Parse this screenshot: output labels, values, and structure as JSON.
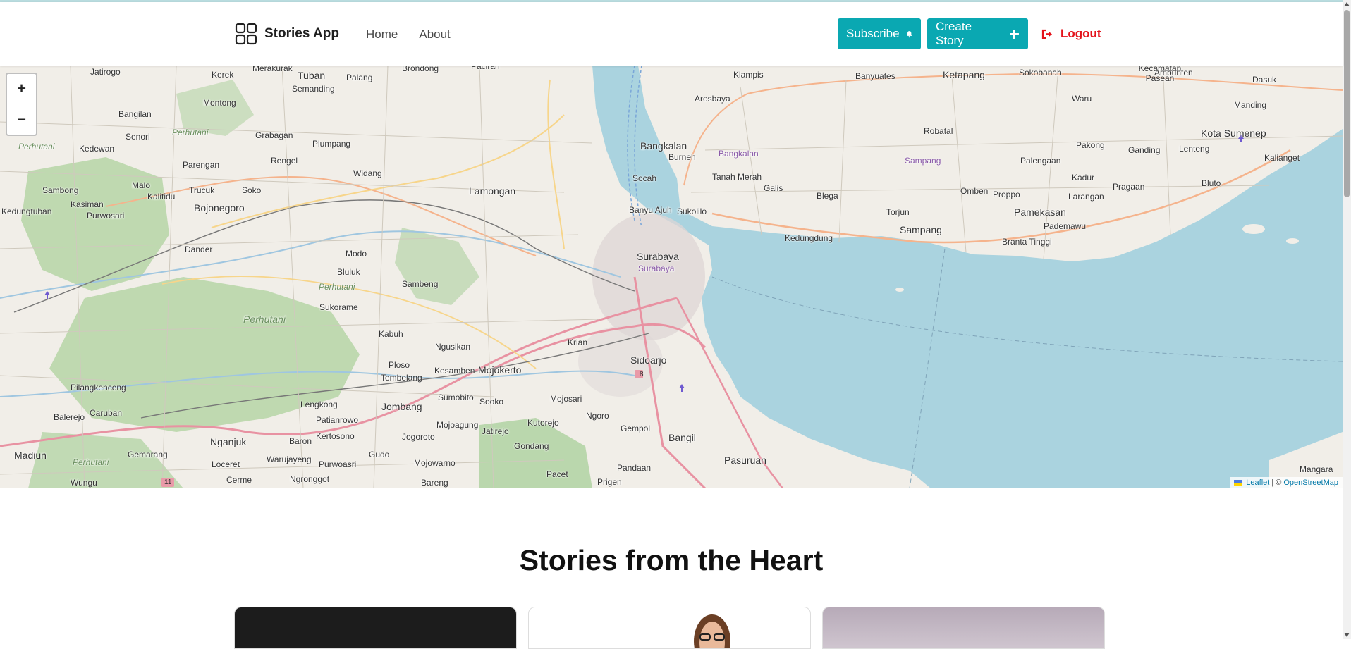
{
  "app": {
    "brand_name": "Stories App",
    "nav": {
      "home": "Home",
      "about": "About"
    },
    "buttons": {
      "subscribe": "Subscribe",
      "create_story": "Create Story",
      "logout": "Logout"
    },
    "accent_color": "#0aa8b2",
    "logout_color": "#e4131b"
  },
  "map": {
    "zoom_in": "+",
    "zoom_out": "−",
    "attribution": {
      "leaflet": "Leaflet",
      "separator": "| ©",
      "osm": "OpenStreetMap"
    },
    "labels": {
      "jatirogo": "Jatirogo",
      "merakurak": "Merakurak",
      "tuban": "Tuban",
      "palang": "Palang",
      "brondong": "Brondong",
      "paciran": "Paciran",
      "kerek": "Kerek",
      "semanding": "Semanding",
      "montong": "Montong",
      "bangilan": "Bangilan",
      "perhutani1": "Perhutani",
      "senori": "Senori",
      "grabagan": "Grabagan",
      "plumpang": "Plumpang",
      "perhutani2": "Perhutani",
      "kedewan": "Kedewan",
      "parengan": "Parengan",
      "rengel": "Rengel",
      "widang": "Widang",
      "lamongan": "Lamongan",
      "sambong": "Sambong",
      "malo": "Malo",
      "trucuk": "Trucuk",
      "soko": "Soko",
      "kasiman": "Kasiman",
      "kalitidu": "Kalitidu",
      "bojonegoro": "Bojonegoro",
      "kedungtuban": "Kedungtuban",
      "purwosari": "Purwosari",
      "dander": "Dander",
      "modo": "Modo",
      "bluluk": "Bluluk",
      "sambeng": "Sambeng",
      "perhutani3": "Perhutani",
      "sukorame": "Sukorame",
      "perhutani4": "Perhutani",
      "kabuh": "Kabuh",
      "ngusikan": "Ngusikan",
      "ploso": "Ploso",
      "kesamben": "Kesamben",
      "mojokerto": "Mojokerto",
      "tembelang": "Tembelang",
      "pilangkenceng": "Pilangkenceng",
      "lengkong": "Lengkong",
      "sumobito": "Sumobito",
      "sooko": "Sooko",
      "jombang": "Jombang",
      "balerejo": "Balerejo",
      "caruban": "Caruban",
      "patianrowo": "Patianrowo",
      "kertosono": "Kertosono",
      "mojoagung": "Mojoagung",
      "jatirejo": "Jatirejo",
      "kutorejo": "Kutorejo",
      "jogoroto": "Jogoroto",
      "nganjuk": "Nganjuk",
      "baron": "Baron",
      "madiun": "Madiun",
      "gemarang": "Gemarang",
      "warujayeng": "Warujayeng",
      "gudo": "Gudo",
      "perhutani5": "Perhutani",
      "loceret": "Loceret",
      "purwoasri": "Purwoasri",
      "mojowarno": "Mojowarno",
      "wungu": "Wungu",
      "cerme": "Cerme",
      "ngronggot": "Ngronggot",
      "bareng": "Bareng",
      "gondang": "Gondang",
      "pacet": "Pacet",
      "prigen": "Prigen",
      "pandaan": "Pandaan",
      "ngoro": "Ngoro",
      "gempol": "Gempol",
      "bangil": "Bangil",
      "pasuruan": "Pasuruan",
      "mojosari": "Mojosari",
      "krian": "Krian",
      "sidoarjo": "Sidoarjo",
      "surabaya": "Surabaya",
      "surabaya_admin": "Surabaya",
      "arosbaya": "Arosbaya",
      "bangkalan": "Bangkalan",
      "burneh": "Burneh",
      "bangkalan_admin": "Bangkalan",
      "socah": "Socah",
      "tanah_merah": "Tanah Merah",
      "galis": "Galis",
      "banyu_ajuh": "Banyu Ajuh",
      "sukolilo": "Sukolilo",
      "blega": "Blega",
      "kedungdung": "Kedungdung",
      "klampis": "Klampis",
      "banyuates": "Banyuates",
      "ketapang": "Ketapang",
      "sokobanah": "Sokobanah",
      "robatal": "Robatal",
      "sampang_admin": "Sampang",
      "torjun": "Torjun",
      "sampang": "Sampang",
      "omben": "Omben",
      "palengaan": "Palengaan",
      "proppo": "Proppo",
      "pamekasan": "Pamekasan",
      "branta_tinggi": "Branta Tinggi",
      "pademawu": "Pademawu",
      "pakong": "Pakong",
      "waru": "Waru",
      "kadur": "Kadur",
      "larangan": "Larangan",
      "pragaan": "Pragaan",
      "bluto": "Bluto",
      "ganding": "Ganding",
      "lenteng": "Lenteng",
      "kecamatan_pasean": "Kecamatan Pasean",
      "ambunten": "Ambunten",
      "dasuk": "Dasuk",
      "manding": "Manding",
      "kota_sumenep": "Kota Sumenep",
      "kalianget": "Kalianget",
      "mangara": "Mangara",
      "route_8": "8",
      "route_11": "11"
    }
  },
  "section": {
    "title": "Stories from the Heart"
  }
}
